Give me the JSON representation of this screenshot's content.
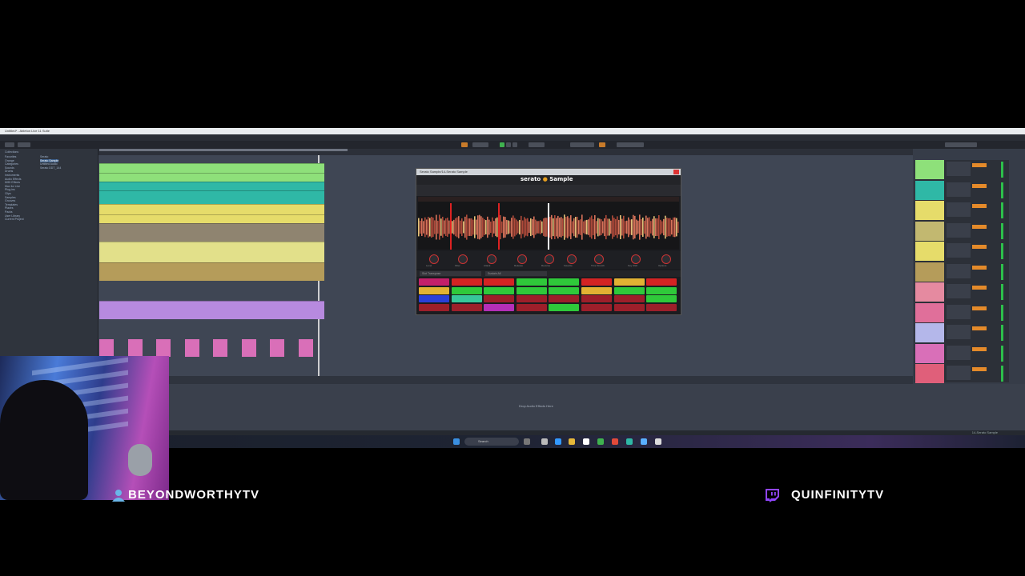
{
  "window": {
    "title": "Untitled* - Ableton Live 11 Suite"
  },
  "menu": [
    "File",
    "Edit",
    "Create",
    "View",
    "Options",
    "Help"
  ],
  "browser": {
    "header": "Collections",
    "items": [
      "Favorites",
      "Orange",
      "Categories",
      "Sounds",
      "Drums",
      "Instruments",
      "Audio Effects",
      "MIDI Effects",
      "Max for Live",
      "Plug-ins",
      "Clips",
      "Samples",
      "Grooves",
      "Templates",
      "Places",
      "Packs",
      "User Library",
      "Current Project"
    ],
    "files": [
      "Serato",
      "Serato Sample",
      "Untitled Audio",
      "Serato DDT_144"
    ]
  },
  "serato": {
    "window_title": "Serato Sample/14-Serato Sample",
    "logo_text": "serato",
    "logo_sub": "Sample",
    "knob_labels": [
      "Level",
      "Filter",
      "Attack",
      "Release",
      "Reverse",
      "Favorite",
      "Time Stretch",
      "Key Shift",
      "Options"
    ],
    "pad_controls": [
      "Slot Transpose",
      "Sustain All"
    ]
  },
  "detail": {
    "hint": "Drop Audio Effects Here"
  },
  "statusbar": {
    "text": "14-Serato Sample"
  },
  "taskbar": {
    "search": "Search"
  },
  "overlay": {
    "left_handle": "BEYONDWORTHYTV",
    "right_handle": "QUINFINITYTV"
  },
  "colors": {
    "track_green": "#8ee07a",
    "track_teal": "#2fb8a6",
    "track_yellow": "#e6dc6a",
    "track_tan": "#b59c5a",
    "track_purple": "#b78adf",
    "track_pink": "#d96fb8",
    "serato_red": "#d42323",
    "serato_green": "#2fc93a"
  }
}
